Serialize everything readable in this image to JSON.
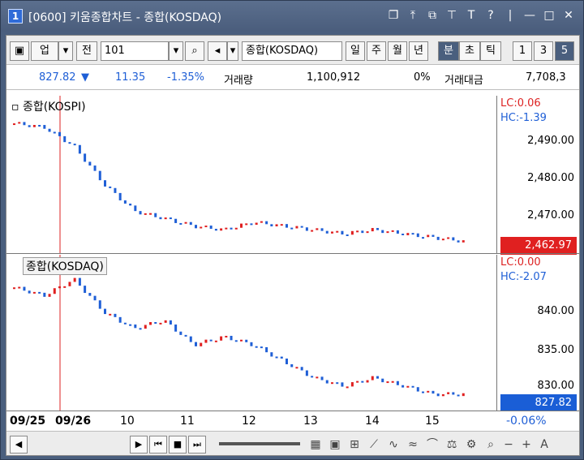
{
  "title": {
    "badge": "1",
    "text": "[0600] 키움종합차트 - 종합(KOSDAQ)"
  },
  "toolbar": {
    "type_label": "업",
    "jeon_label": "전",
    "code_value": "101",
    "index_name": "종합(KOSDAQ)",
    "periods": [
      "일",
      "주",
      "월",
      "년"
    ],
    "active_period": "분",
    "tick": "초",
    "tick2": "틱",
    "nums": [
      "1",
      "3",
      "5"
    ]
  },
  "info": {
    "price": "827.82",
    "arrow": "▼",
    "change": "11.35",
    "pct": "-1.35%",
    "vol_label": "거래량",
    "vol": "1,100,912",
    "vol_pct": "0%",
    "amt_label": "거래대금",
    "amt": "7,708,3"
  },
  "top_pane": {
    "label": "종합(KOSPI)",
    "lc": "LC:0.06",
    "hc": "HC:-1.39",
    "ticks": [
      "2,490.00",
      "2,480.00",
      "2,470.00"
    ],
    "last": "2,462.97"
  },
  "bottom_pane": {
    "label": "종합(KOSDAQ)",
    "lc": "LC:0.00",
    "hc": "HC:-2.07",
    "ticks": [
      "840.00",
      "835.00",
      "830.00"
    ],
    "last": "827.82",
    "last_pct": "-0.06%"
  },
  "xaxis": [
    "09/25",
    "09/26",
    "10",
    "11",
    "12",
    "13",
    "14",
    "15"
  ],
  "colors": {
    "up": "#e02020",
    "down": "#1f5fd6",
    "frame": "#4a5f7e"
  },
  "icons": [
    "restore-icon",
    "pin-icon",
    "copy-icon",
    "tool-icon",
    "font-icon",
    "help-icon",
    "minimize-icon",
    "maximize-icon",
    "close-icon"
  ],
  "chart_data": [
    {
      "type": "candlestick",
      "title": "종합(KOSPI)",
      "ylim": [
        2462,
        2497
      ],
      "x": [
        "09/25",
        "09/26",
        "10",
        "11",
        "12",
        "13",
        "14",
        "15"
      ],
      "close_trend": [
        2494,
        2493,
        2488,
        2478,
        2471,
        2469,
        2467,
        2466,
        2468,
        2467,
        2466,
        2465,
        2466,
        2465,
        2464,
        2463
      ]
    },
    {
      "type": "candlestick",
      "title": "종합(KOSDAQ)",
      "ylim": [
        827,
        843
      ],
      "x": [
        "09/25",
        "09/26",
        "10",
        "11",
        "12",
        "13",
        "14",
        "15"
      ],
      "close_trend": [
        841,
        840,
        842,
        838,
        836,
        837,
        834,
        835,
        834,
        832,
        830,
        829,
        830,
        829,
        828,
        828
      ]
    }
  ]
}
